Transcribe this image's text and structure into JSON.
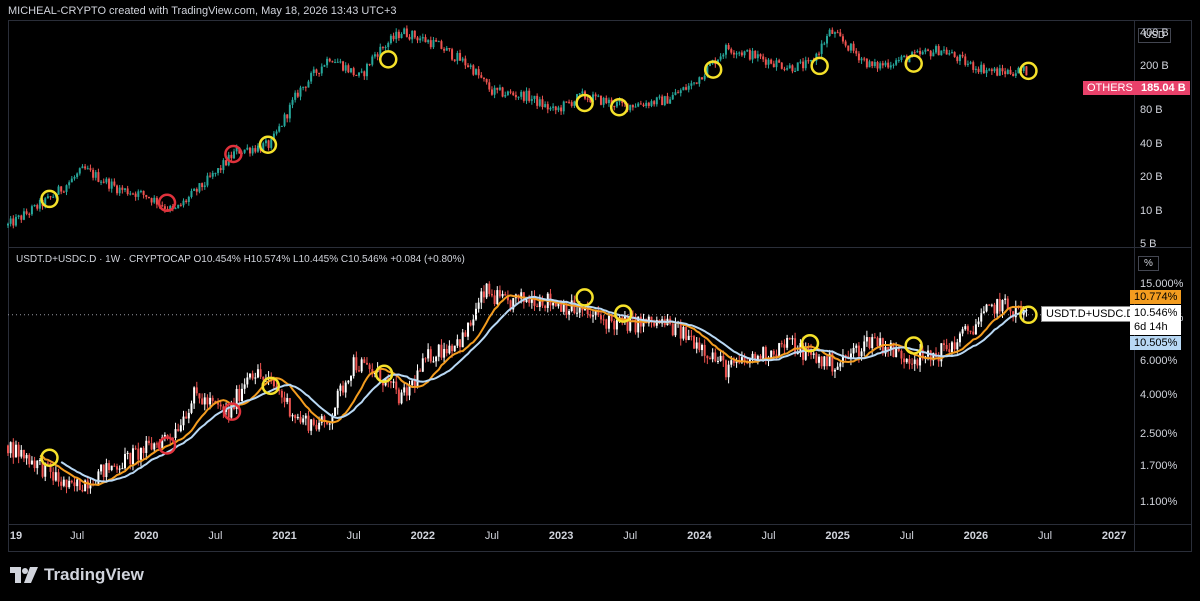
{
  "header": {
    "attribution": "MICHEAL-CRYPTO created with TradingView.com, May 18, 2026 13:43 UTC+3"
  },
  "top_pane": {
    "unit": "USD",
    "y_ticks": [
      "400 B",
      "200 B",
      "80 B",
      "40 B",
      "20 B",
      "10 B",
      "5 B"
    ],
    "symbol_tag": "OTHERS",
    "last_value": "185.04 B"
  },
  "bottom_pane": {
    "unit": "%",
    "legend": "USDT.D+USDC.D · 1W · CRYPTOCAP  O10.454%  H10.574%  L10.445%  C10.546%  +0.084 (+0.80%)",
    "y_ticks": [
      "15.000%",
      "10.000%",
      "6.000%",
      "4.000%",
      "2.500%",
      "1.700%",
      "1.100%"
    ],
    "symbol_label": "USDT.D+USDC.D",
    "last_value": "10.546%",
    "countdown": "6d 14h",
    "ma_orange_value": "10.774%",
    "ma_blue_value": "10.505%"
  },
  "x_axis": {
    "labels": [
      {
        "t": "19",
        "bold": true
      },
      {
        "t": "Jul",
        "bold": false
      },
      {
        "t": "2020",
        "bold": true
      },
      {
        "t": "Jul",
        "bold": false
      },
      {
        "t": "2021",
        "bold": true
      },
      {
        "t": "Jul",
        "bold": false
      },
      {
        "t": "2022",
        "bold": true
      },
      {
        "t": "Jul",
        "bold": false
      },
      {
        "t": "2023",
        "bold": true
      },
      {
        "t": "Jul",
        "bold": false
      },
      {
        "t": "2024",
        "bold": true
      },
      {
        "t": "Jul",
        "bold": false
      },
      {
        "t": "2025",
        "bold": true
      },
      {
        "t": "Jul",
        "bold": false
      },
      {
        "t": "2026",
        "bold": true
      },
      {
        "t": "Jul",
        "bold": false
      },
      {
        "t": "2027",
        "bold": true
      }
    ]
  },
  "branding": {
    "logo_text": "TradingView"
  },
  "colors": {
    "bull": "#26a69a",
    "bear": "#ef5350",
    "ma_orange": "#f39c1f",
    "ma_blue": "#b8d8f4",
    "circle_yellow": "#f5e12a",
    "circle_red": "#e0323c",
    "tag_pink": "#e8416a"
  },
  "chart_data": [
    {
      "type": "candlestick",
      "title": "OTHERS",
      "unit": "USD",
      "scale": "log",
      "ylim": [
        5,
        450
      ],
      "x_unit": "decimal year",
      "anchors": [
        [
          2019.0,
          7.5
        ],
        [
          2019.3,
          13
        ],
        [
          2019.55,
          24
        ],
        [
          2019.8,
          16
        ],
        [
          2020.0,
          14
        ],
        [
          2020.2,
          10
        ],
        [
          2020.5,
          22
        ],
        [
          2020.65,
          35
        ],
        [
          2020.9,
          40
        ],
        [
          2021.1,
          120
        ],
        [
          2021.33,
          250
        ],
        [
          2021.55,
          160
        ],
        [
          2021.65,
          260
        ],
        [
          2021.85,
          420
        ],
        [
          2022.1,
          320
        ],
        [
          2022.35,
          200
        ],
        [
          2022.5,
          120
        ],
        [
          2022.75,
          110
        ],
        [
          2022.95,
          80
        ],
        [
          2023.15,
          110
        ],
        [
          2023.45,
          90
        ],
        [
          2023.75,
          100
        ],
        [
          2023.95,
          140
        ],
        [
          2024.2,
          300
        ],
        [
          2024.45,
          240
        ],
        [
          2024.65,
          200
        ],
        [
          2024.8,
          210
        ],
        [
          2024.95,
          420
        ],
        [
          2025.25,
          200
        ],
        [
          2025.55,
          250
        ],
        [
          2025.75,
          290
        ],
        [
          2025.95,
          210
        ],
        [
          2026.15,
          180
        ],
        [
          2026.38,
          185
        ]
      ],
      "circles": [
        {
          "x": 2019.3,
          "y": 13,
          "color": "yellow"
        },
        {
          "x": 2020.15,
          "y": 12,
          "color": "red"
        },
        {
          "x": 2020.63,
          "y": 33,
          "color": "red"
        },
        {
          "x": 2020.88,
          "y": 40,
          "color": "yellow"
        },
        {
          "x": 2021.75,
          "y": 235,
          "color": "yellow"
        },
        {
          "x": 2023.17,
          "y": 95,
          "color": "yellow"
        },
        {
          "x": 2023.42,
          "y": 87,
          "color": "yellow"
        },
        {
          "x": 2024.1,
          "y": 190,
          "color": "yellow"
        },
        {
          "x": 2024.87,
          "y": 205,
          "color": "yellow"
        },
        {
          "x": 2025.55,
          "y": 215,
          "color": "yellow"
        },
        {
          "x": 2026.38,
          "y": 185,
          "color": "yellow"
        }
      ]
    },
    {
      "type": "candlestick",
      "title": "USDT.D+USDC.D",
      "unit": "%",
      "scale": "log",
      "ylim": [
        0.9,
        17
      ],
      "x_unit": "decimal year",
      "anchors": [
        [
          2019.0,
          2.2
        ],
        [
          2019.2,
          1.8
        ],
        [
          2019.45,
          1.3
        ],
        [
          2019.75,
          1.7
        ],
        [
          2020.0,
          2.1
        ],
        [
          2020.2,
          2.6
        ],
        [
          2020.35,
          4.0
        ],
        [
          2020.6,
          3.2
        ],
        [
          2020.75,
          5.5
        ],
        [
          2020.95,
          4.3
        ],
        [
          2021.1,
          3.0
        ],
        [
          2021.3,
          2.8
        ],
        [
          2021.5,
          6.0
        ],
        [
          2021.7,
          5.0
        ],
        [
          2021.85,
          3.8
        ],
        [
          2022.05,
          6.5
        ],
        [
          2022.3,
          8.0
        ],
        [
          2022.45,
          14.0
        ],
        [
          2022.6,
          12.0
        ],
        [
          2022.8,
          13.0
        ],
        [
          2023.0,
          12.0
        ],
        [
          2023.2,
          10.5
        ],
        [
          2023.4,
          9.5
        ],
        [
          2023.75,
          9.5
        ],
        [
          2024.0,
          7.5
        ],
        [
          2024.2,
          5.5
        ],
        [
          2024.45,
          6.5
        ],
        [
          2024.65,
          7.5
        ],
        [
          2024.85,
          6.2
        ],
        [
          2025.0,
          5.8
        ],
        [
          2025.25,
          8.0
        ],
        [
          2025.45,
          6.5
        ],
        [
          2025.65,
          6.2
        ],
        [
          2025.85,
          7.5
        ],
        [
          2026.0,
          9.5
        ],
        [
          2026.15,
          12.0
        ],
        [
          2026.38,
          10.546
        ]
      ],
      "series": [
        {
          "name": "",
          "color": "orange"
        },
        {
          "name": "",
          "color": "blue"
        }
      ],
      "circles": [
        {
          "x": 2019.3,
          "y": 1.9,
          "color": "yellow"
        },
        {
          "x": 2020.15,
          "y": 2.2,
          "color": "red"
        },
        {
          "x": 2020.62,
          "y": 3.3,
          "color": "red"
        },
        {
          "x": 2020.9,
          "y": 4.5,
          "color": "yellow"
        },
        {
          "x": 2021.72,
          "y": 5.2,
          "color": "yellow"
        },
        {
          "x": 2023.17,
          "y": 13.0,
          "color": "yellow"
        },
        {
          "x": 2023.45,
          "y": 10.7,
          "color": "yellow"
        },
        {
          "x": 2024.8,
          "y": 7.5,
          "color": "yellow"
        },
        {
          "x": 2025.55,
          "y": 7.3,
          "color": "yellow"
        },
        {
          "x": 2026.38,
          "y": 10.546,
          "color": "yellow"
        }
      ]
    }
  ]
}
